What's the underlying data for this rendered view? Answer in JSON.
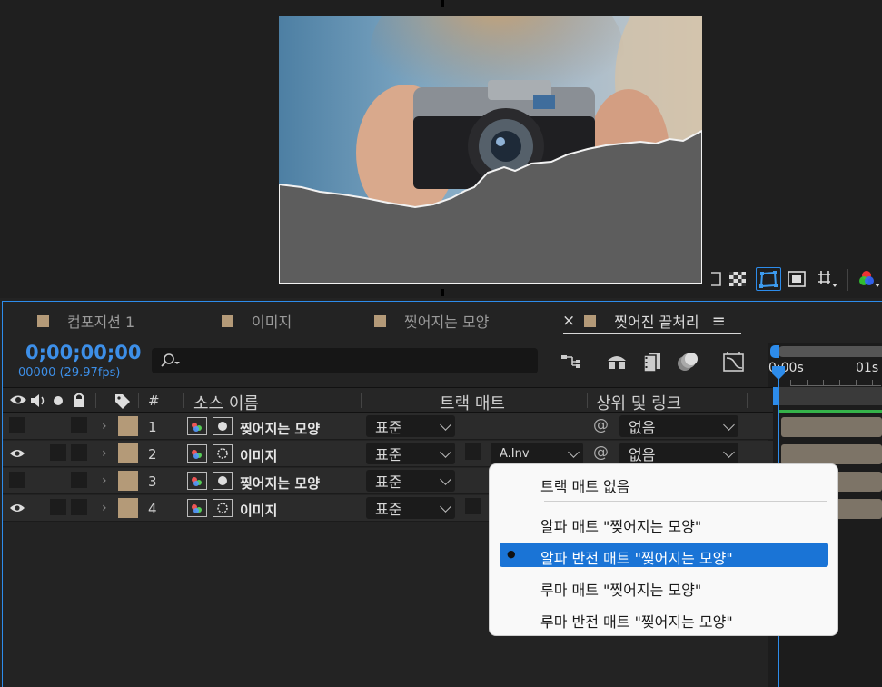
{
  "tabs": [
    {
      "label": "컴포지션 1",
      "active": false
    },
    {
      "label": "이미지",
      "active": false
    },
    {
      "label": "찢어지는 모양",
      "active": false
    },
    {
      "label": "찢어진 끝처리",
      "active": true
    }
  ],
  "tab_close": "×",
  "panel_menu": "≡",
  "timecode": "0;00;00;00",
  "fps": "00000 (29.97fps)",
  "ruler": {
    "t0": "0:00s",
    "t1": "01s"
  },
  "headers": {
    "num": "#",
    "source_name": "소스 이름",
    "track_matte": "트랙 매트",
    "parent_link": "상위 및 링크"
  },
  "layers": [
    {
      "num": "1",
      "name": "찢어지는 모양",
      "mode": "표준",
      "matte": "",
      "parent": "없음",
      "visible": false
    },
    {
      "num": "2",
      "name": "이미지",
      "mode": "표준",
      "matte": "A.Inv",
      "parent": "없음",
      "visible": true
    },
    {
      "num": "3",
      "name": "찢어지는 모양",
      "mode": "표준",
      "matte": "",
      "parent": "",
      "visible": false
    },
    {
      "num": "4",
      "name": "이미지",
      "mode": "표준",
      "matte": "",
      "parent": "",
      "visible": true
    }
  ],
  "menu": {
    "items": [
      "트랙 매트 없음",
      "알파 매트 \"찢어지는 모양\"",
      "알파 반전 매트 \"찢어지는 모양\"",
      "루마 매트 \"찢어지는 모양\"",
      "루마 반전 매트 \"찢어지는 모양\""
    ],
    "selected_index": 2,
    "bullet": "●"
  },
  "colors": {
    "accent": "#2d8ceb",
    "label_color": "#b49a78",
    "menu_highlight": "#1a74d6",
    "layer_bar": "#7d7467"
  }
}
